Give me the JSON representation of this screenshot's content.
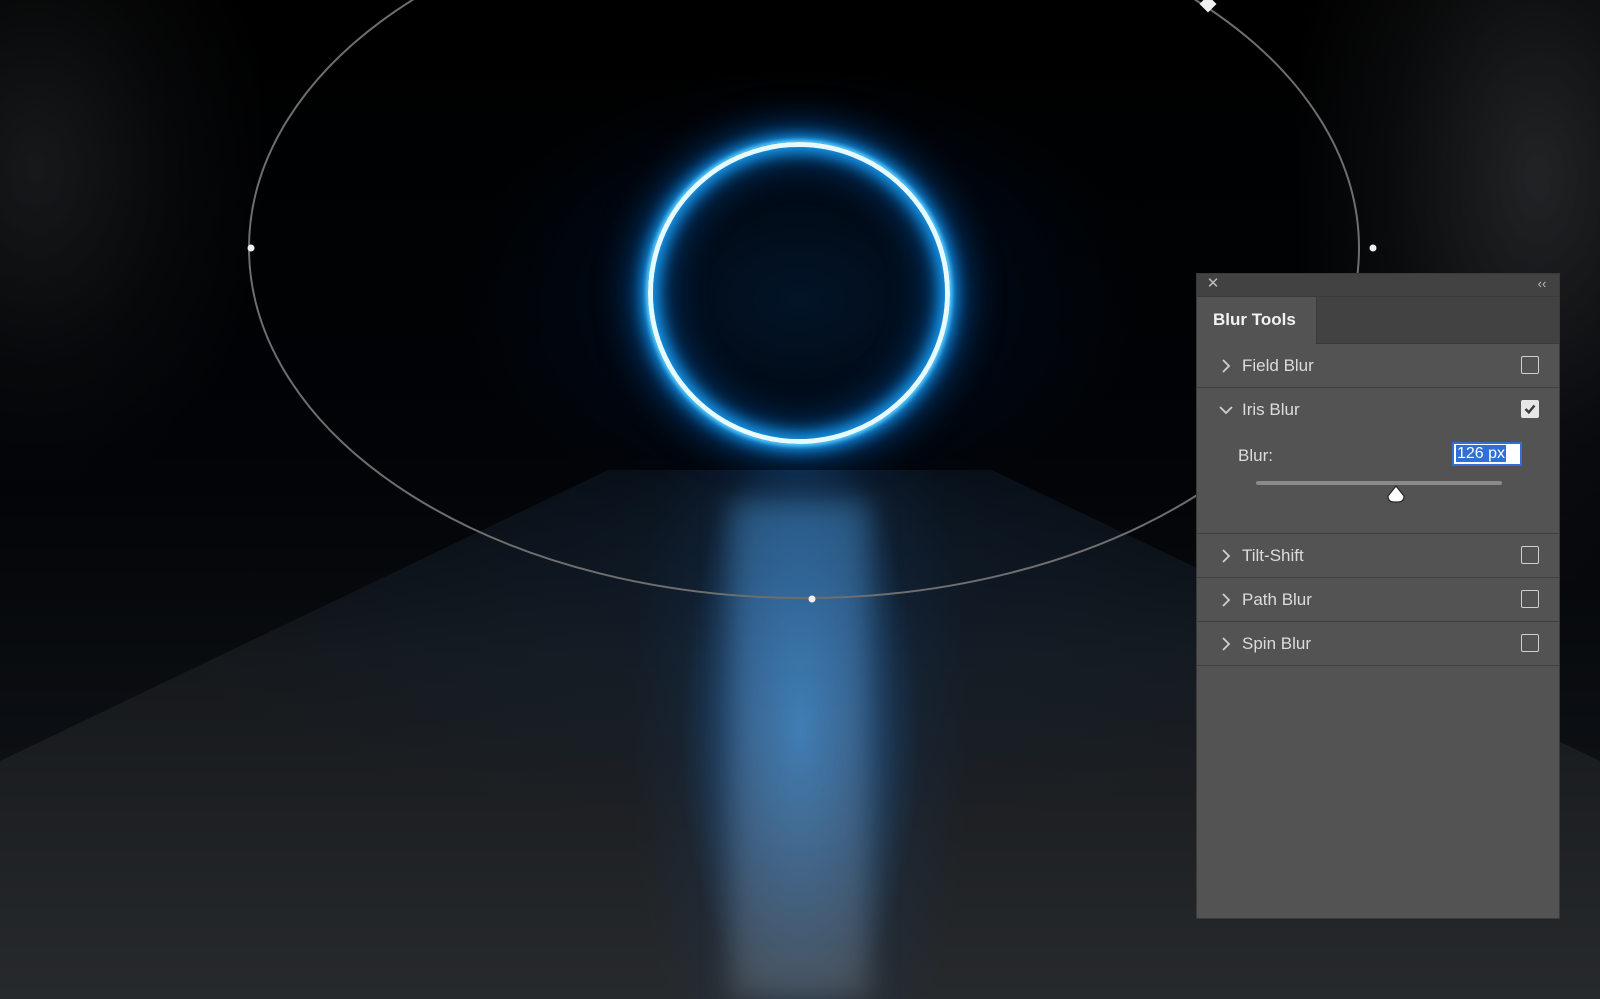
{
  "panel": {
    "close_icon": "close-icon",
    "collapse_icon": "collapse-double-chevron-icon",
    "tab": "Blur Tools",
    "sections": [
      {
        "label": "Field Blur",
        "expanded": false,
        "checked": false
      },
      {
        "label": "Iris Blur",
        "expanded": true,
        "checked": true
      },
      {
        "label": "Tilt-Shift",
        "expanded": false,
        "checked": false
      },
      {
        "label": "Path Blur",
        "expanded": false,
        "checked": false
      },
      {
        "label": "Spin Blur",
        "expanded": false,
        "checked": false
      }
    ],
    "iris": {
      "blur_label": "Blur:",
      "blur_value": "126 px",
      "slider_fraction": 0.57
    }
  },
  "colors": {
    "panel_bg": "#535353",
    "panel_header": "#424242",
    "input_focus": "#2f6fd6",
    "neon": "#1aa6ff"
  }
}
